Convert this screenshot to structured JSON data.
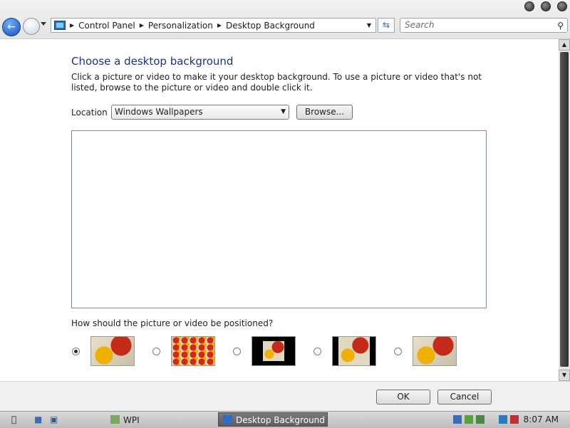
{
  "address_bar": {
    "breadcrumbs": [
      "Control Panel",
      "Personalization",
      "Desktop Background"
    ]
  },
  "search": {
    "placeholder": "Search"
  },
  "main": {
    "heading": "Choose a desktop background",
    "intro": "Click a picture or video to make it your desktop background. To use a picture or video that's not listed, browse to the picture or video and double click it.",
    "location_label": "Location",
    "location_value": "Windows Wallpapers",
    "browse_label": "Browse...",
    "position_question": "How should the picture or video be positioned?",
    "position_selected_index": 0
  },
  "footer": {
    "ok_label": "OK",
    "cancel_label": "Cancel"
  },
  "taskbar": {
    "items": [
      "WPI",
      "Desktop Background"
    ],
    "clock": "8:07 AM"
  },
  "icons": {
    "back": "back-arrow-icon",
    "forward": "forward-arrow-icon",
    "refresh": "refresh-icon",
    "search": "search-icon",
    "location_dropdown": "chevron-down-icon"
  }
}
